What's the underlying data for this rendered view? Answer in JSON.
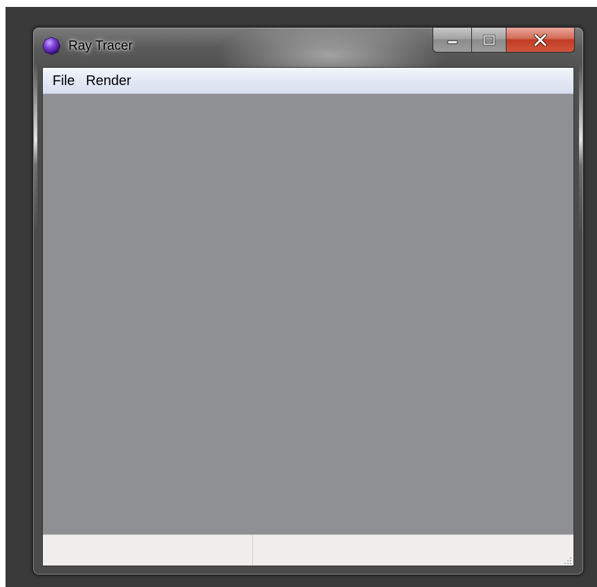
{
  "window": {
    "title": "Ray Tracer",
    "icon": "purple-sphere-icon",
    "caption_buttons": [
      "minimize-icon",
      "maximize-icon",
      "close-icon"
    ]
  },
  "menubar": {
    "items": [
      {
        "label": "File"
      },
      {
        "label": "Render"
      }
    ]
  },
  "statusbar": {
    "panes": [
      "",
      ""
    ]
  },
  "colors": {
    "desktop": "#3a3a3a",
    "canvas": "#8f9094",
    "menubar": "#e3e8f5",
    "statusbar": "#f0eded",
    "close_button": "#c23a23",
    "app_icon": "#7b3fd6"
  }
}
